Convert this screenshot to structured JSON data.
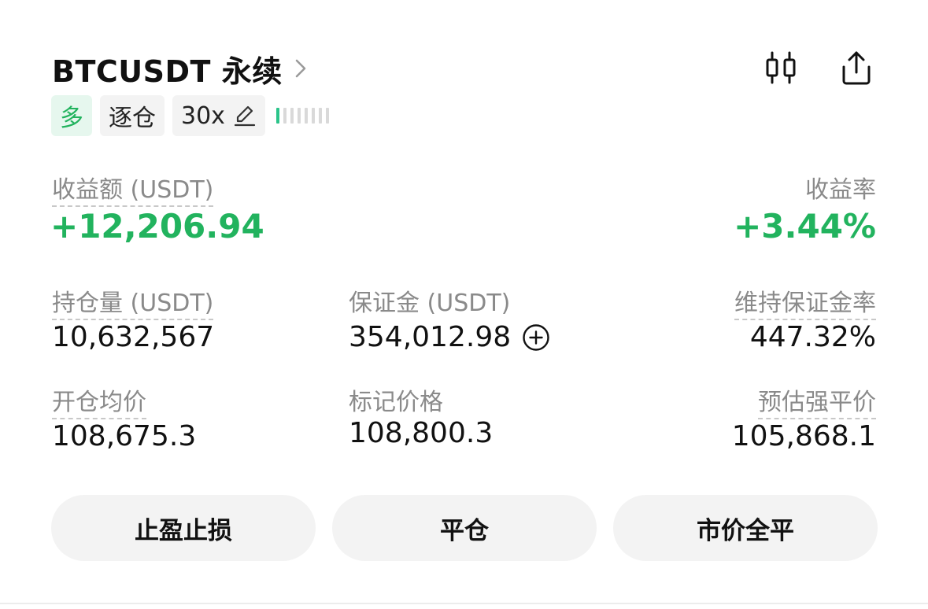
{
  "header": {
    "symbol": "BTCUSDT 永续",
    "icons": [
      "chevron-right-icon",
      "candlestick-chart-icon",
      "share-icon"
    ]
  },
  "tags": {
    "side": "多",
    "margin_mode": "逐仓",
    "leverage": "30x",
    "risk_level": 0.125
  },
  "pnl": {
    "label": "收益额 (USDT)",
    "value": "+12,206.94",
    "rate_label": "收益率",
    "rate_value": "+3.44%"
  },
  "stats": {
    "position_size": {
      "label": "持仓量 (USDT)",
      "value": "10,632,567"
    },
    "margin": {
      "label": "保证金 (USDT)",
      "value": "354,012.98"
    },
    "maintenance_ratio": {
      "label": "维持保证金率",
      "value": "447.32%"
    },
    "entry_price": {
      "label": "开仓均价",
      "value": "108,675.3"
    },
    "mark_price": {
      "label": "标记价格",
      "value": "108,800.3"
    },
    "liq_price": {
      "label": "预估强平价",
      "value": "105,868.1"
    }
  },
  "actions": {
    "tp_sl": "止盈止损",
    "close": "平仓",
    "market_close_all": "市价全平"
  },
  "colors": {
    "profit": "#22b35e",
    "long_tag_bg": "#e6f7ee",
    "button_bg": "#f3f3f3",
    "label": "#8a8a8a"
  }
}
